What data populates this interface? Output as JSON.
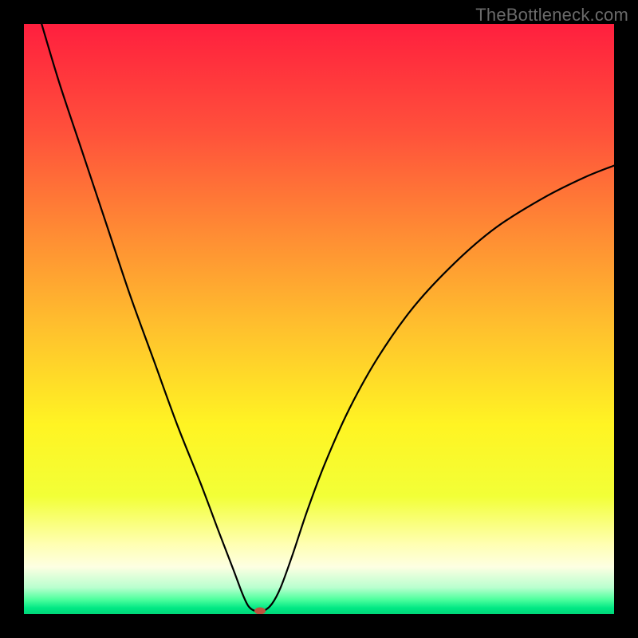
{
  "watermark": "TheBottleneck.com",
  "chart_data": {
    "type": "line",
    "title": "",
    "xlabel": "",
    "ylabel": "",
    "xlim": [
      0,
      100
    ],
    "ylim": [
      0,
      100
    ],
    "grid": false,
    "legend": false,
    "background_gradient_stops": [
      {
        "offset": 0.0,
        "color": "#ff1f3e"
      },
      {
        "offset": 0.18,
        "color": "#ff503b"
      },
      {
        "offset": 0.35,
        "color": "#ff8a34"
      },
      {
        "offset": 0.52,
        "color": "#ffc22d"
      },
      {
        "offset": 0.68,
        "color": "#fff423"
      },
      {
        "offset": 0.8,
        "color": "#f2ff37"
      },
      {
        "offset": 0.88,
        "color": "#ffffb0"
      },
      {
        "offset": 0.92,
        "color": "#fdffe2"
      },
      {
        "offset": 0.955,
        "color": "#b9ffcf"
      },
      {
        "offset": 0.975,
        "color": "#4fff9e"
      },
      {
        "offset": 0.99,
        "color": "#00e884"
      },
      {
        "offset": 1.0,
        "color": "#00d779"
      }
    ],
    "series": [
      {
        "name": "bottleneck-curve",
        "color": "#000000",
        "stroke_width": 2.2,
        "points": [
          {
            "x": 3.0,
            "y": 100.0
          },
          {
            "x": 6.0,
            "y": 90.0
          },
          {
            "x": 10.0,
            "y": 78.0
          },
          {
            "x": 14.0,
            "y": 66.0
          },
          {
            "x": 18.0,
            "y": 54.0
          },
          {
            "x": 22.0,
            "y": 43.0
          },
          {
            "x": 26.0,
            "y": 32.0
          },
          {
            "x": 30.0,
            "y": 22.0
          },
          {
            "x": 33.0,
            "y": 14.0
          },
          {
            "x": 35.5,
            "y": 7.5
          },
          {
            "x": 37.0,
            "y": 3.5
          },
          {
            "x": 38.0,
            "y": 1.4
          },
          {
            "x": 39.0,
            "y": 0.6
          },
          {
            "x": 40.5,
            "y": 0.5
          },
          {
            "x": 42.0,
            "y": 1.7
          },
          {
            "x": 43.5,
            "y": 4.5
          },
          {
            "x": 45.5,
            "y": 10.0
          },
          {
            "x": 48.0,
            "y": 17.5
          },
          {
            "x": 51.0,
            "y": 25.5
          },
          {
            "x": 55.0,
            "y": 34.5
          },
          {
            "x": 60.0,
            "y": 43.5
          },
          {
            "x": 66.0,
            "y": 52.0
          },
          {
            "x": 73.0,
            "y": 59.5
          },
          {
            "x": 80.0,
            "y": 65.5
          },
          {
            "x": 88.0,
            "y": 70.5
          },
          {
            "x": 95.0,
            "y": 74.0
          },
          {
            "x": 100.0,
            "y": 76.0
          }
        ]
      }
    ],
    "marker": {
      "name": "optimal-point",
      "x": 40.0,
      "y": 0.0,
      "rx": 7,
      "ry": 4.5,
      "fill": "#c1513e"
    }
  }
}
